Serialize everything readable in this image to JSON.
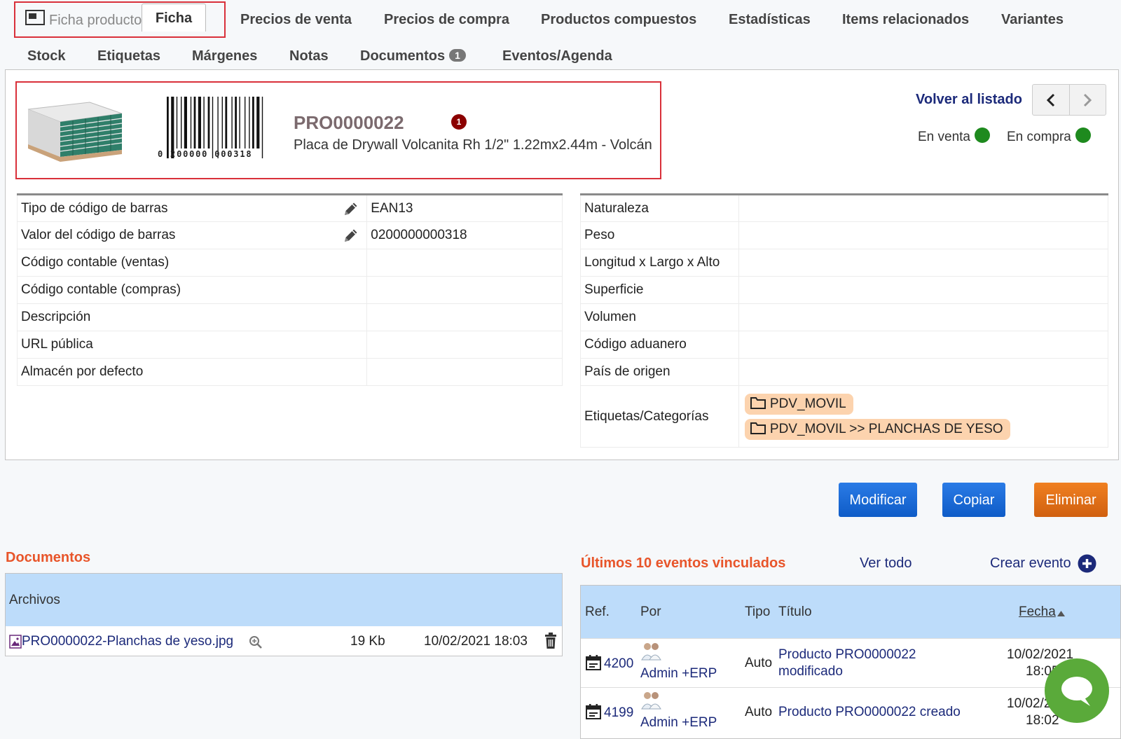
{
  "tabs": {
    "title": "Ficha producto",
    "active": "Ficha",
    "row1": [
      "Precios de venta",
      "Precios de compra",
      "Productos compuestos",
      "Estadísticas",
      "Items relacionados",
      "Variantes"
    ],
    "row2": [
      "Stock",
      "Etiquetas",
      "Márgenes",
      "Notas",
      "Documentos",
      "Eventos/Agenda"
    ],
    "documents_badge": "1"
  },
  "product": {
    "ref": "PRO0000022",
    "warning_badge": "1",
    "label": "Placa de Drywall Volcanita Rh 1/2\" 1.22mx2.44m - Volcán",
    "barcode_text": "0 200000 000318"
  },
  "nav": {
    "back_to_list": "Volver al listado"
  },
  "status": {
    "on_sale_label": "En venta",
    "on_purchase_label": "En compra",
    "color": "#1e8a1e"
  },
  "left_fields": [
    {
      "label": "Tipo de código de barras",
      "value": "EAN13",
      "editable": true
    },
    {
      "label": "Valor del código de barras",
      "value": "0200000000318",
      "editable": true
    },
    {
      "label": "Código contable (ventas)",
      "value": ""
    },
    {
      "label": "Código contable (compras)",
      "value": ""
    },
    {
      "label": "Descripción",
      "value": ""
    },
    {
      "label": "URL pública",
      "value": ""
    },
    {
      "label": "Almacén por defecto",
      "value": ""
    }
  ],
  "right_fields": [
    {
      "label": "Naturaleza",
      "value": ""
    },
    {
      "label": "Peso",
      "value": ""
    },
    {
      "label": "Longitud x Largo x Alto",
      "value": ""
    },
    {
      "label": "Superficie",
      "value": ""
    },
    {
      "label": "Volumen",
      "value": ""
    },
    {
      "label": "Código aduanero",
      "value": ""
    },
    {
      "label": "País de origen",
      "value": ""
    }
  ],
  "categories": {
    "label": "Etiquetas/Categorías",
    "tags": [
      "PDV_MOVIL",
      "PDV_MOVIL >> PLANCHAS DE YESO"
    ]
  },
  "actions": {
    "modify": "Modificar",
    "copy": "Copiar",
    "delete": "Eliminar"
  },
  "documents": {
    "title": "Documentos",
    "header": "Archivos",
    "file": {
      "name": "PRO0000022-Planchas de yeso.jpg",
      "size": "19 Kb",
      "date": "10/02/2021 18:03"
    }
  },
  "events": {
    "title": "Últimos 10 eventos vinculados",
    "see_all": "Ver todo",
    "create": "Crear evento",
    "columns": {
      "ref": "Ref.",
      "by": "Por",
      "type": "Tipo",
      "title": "Título",
      "date": "Fecha"
    },
    "rows": [
      {
        "ref": "4200",
        "by": "Admin +ERP",
        "type": "Auto",
        "title_line1": "Producto PRO0000022",
        "title_line2": "modificado",
        "date_line1": "10/02/2021",
        "date_line2": "18:05"
      },
      {
        "ref": "4199",
        "by": "Admin +ERP",
        "type": "Auto",
        "title_line1": "Producto PRO0000022 creado",
        "title_line2": "",
        "date_line1": "10/02/2021",
        "date_line2": "18:02"
      }
    ]
  },
  "colors": {
    "accent": "#e8552a",
    "link": "#1c2a7a",
    "highlight": "#d9303a",
    "header_bg": "#bddcfa",
    "tag_bg": "#fcd3ae"
  }
}
